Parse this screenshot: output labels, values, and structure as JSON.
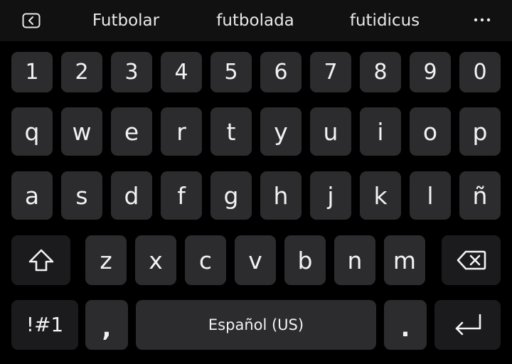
{
  "suggestions": {
    "back_icon": "back-arrow-icon",
    "items": [
      "Futbolar",
      "futbolada",
      "futidicus"
    ],
    "more_icon": "more-horizontal-icon"
  },
  "rows": {
    "digits": [
      "1",
      "2",
      "3",
      "4",
      "5",
      "6",
      "7",
      "8",
      "9",
      "0"
    ],
    "row1": [
      "q",
      "w",
      "e",
      "r",
      "t",
      "y",
      "u",
      "i",
      "o",
      "p"
    ],
    "row2": [
      "a",
      "s",
      "d",
      "f",
      "g",
      "h",
      "j",
      "k",
      "l",
      "ñ"
    ],
    "row3": [
      "z",
      "x",
      "c",
      "v",
      "b",
      "n",
      "m"
    ]
  },
  "bottom": {
    "symbols_label": "!#1",
    "comma_label": ",",
    "space_label": "Español (US)",
    "period_label": "."
  },
  "icons": {
    "shift": "shift-icon",
    "backspace": "backspace-icon",
    "enter": "enter-icon"
  },
  "colors": {
    "background": "#000000",
    "suggestion_bar": "#111111",
    "key": "#2c2c2e",
    "function_key": "#1b1b1d",
    "text": "#f2f2f2"
  }
}
